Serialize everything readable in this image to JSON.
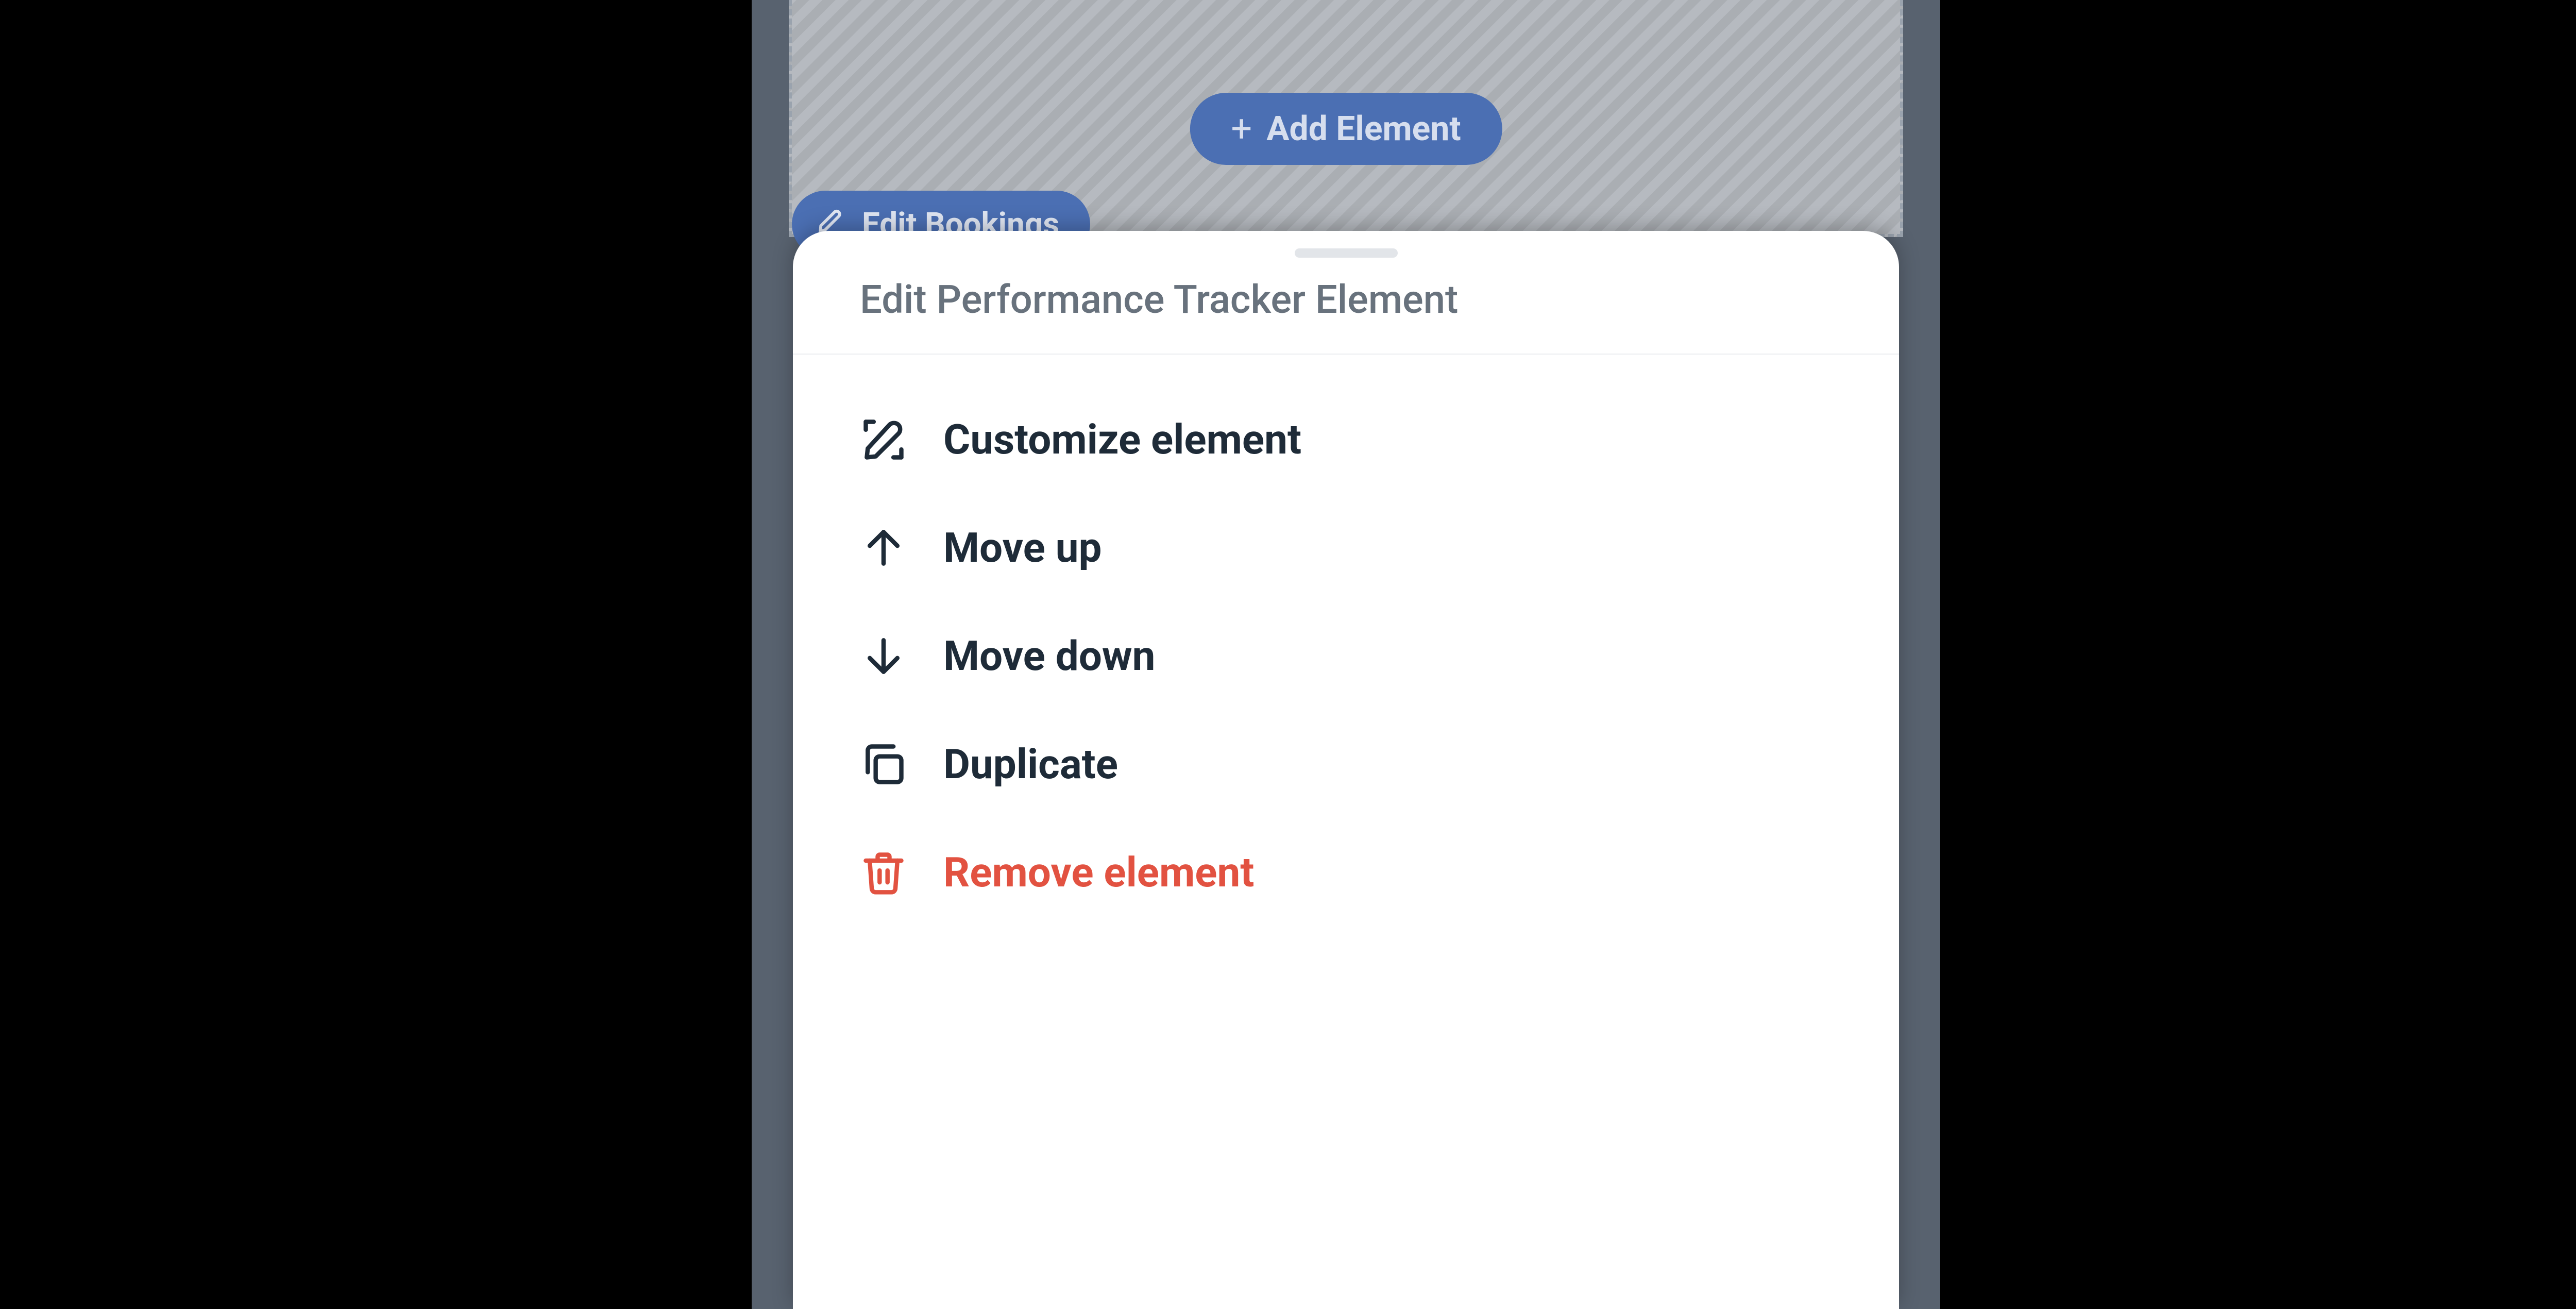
{
  "editor": {
    "add_element_label": "Add Element",
    "edit_bookings_label": "Edit Bookings"
  },
  "sheet": {
    "title": "Edit Performance Tracker Element",
    "items": [
      {
        "label": "Customize element",
        "icon": "customize-icon",
        "destructive": false
      },
      {
        "label": "Move up",
        "icon": "arrow-up-icon",
        "destructive": false
      },
      {
        "label": "Move down",
        "icon": "arrow-down-icon",
        "destructive": false
      },
      {
        "label": "Duplicate",
        "icon": "duplicate-icon",
        "destructive": false
      },
      {
        "label": "Remove element",
        "icon": "trash-icon",
        "destructive": true
      }
    ]
  },
  "colors": {
    "accent": "#4b6fb3",
    "destructive": "#e25241",
    "text_dark": "#1e2b38",
    "text_muted": "#68727d",
    "sheet_bg": "#ffffff",
    "backdrop": "#58626f"
  }
}
